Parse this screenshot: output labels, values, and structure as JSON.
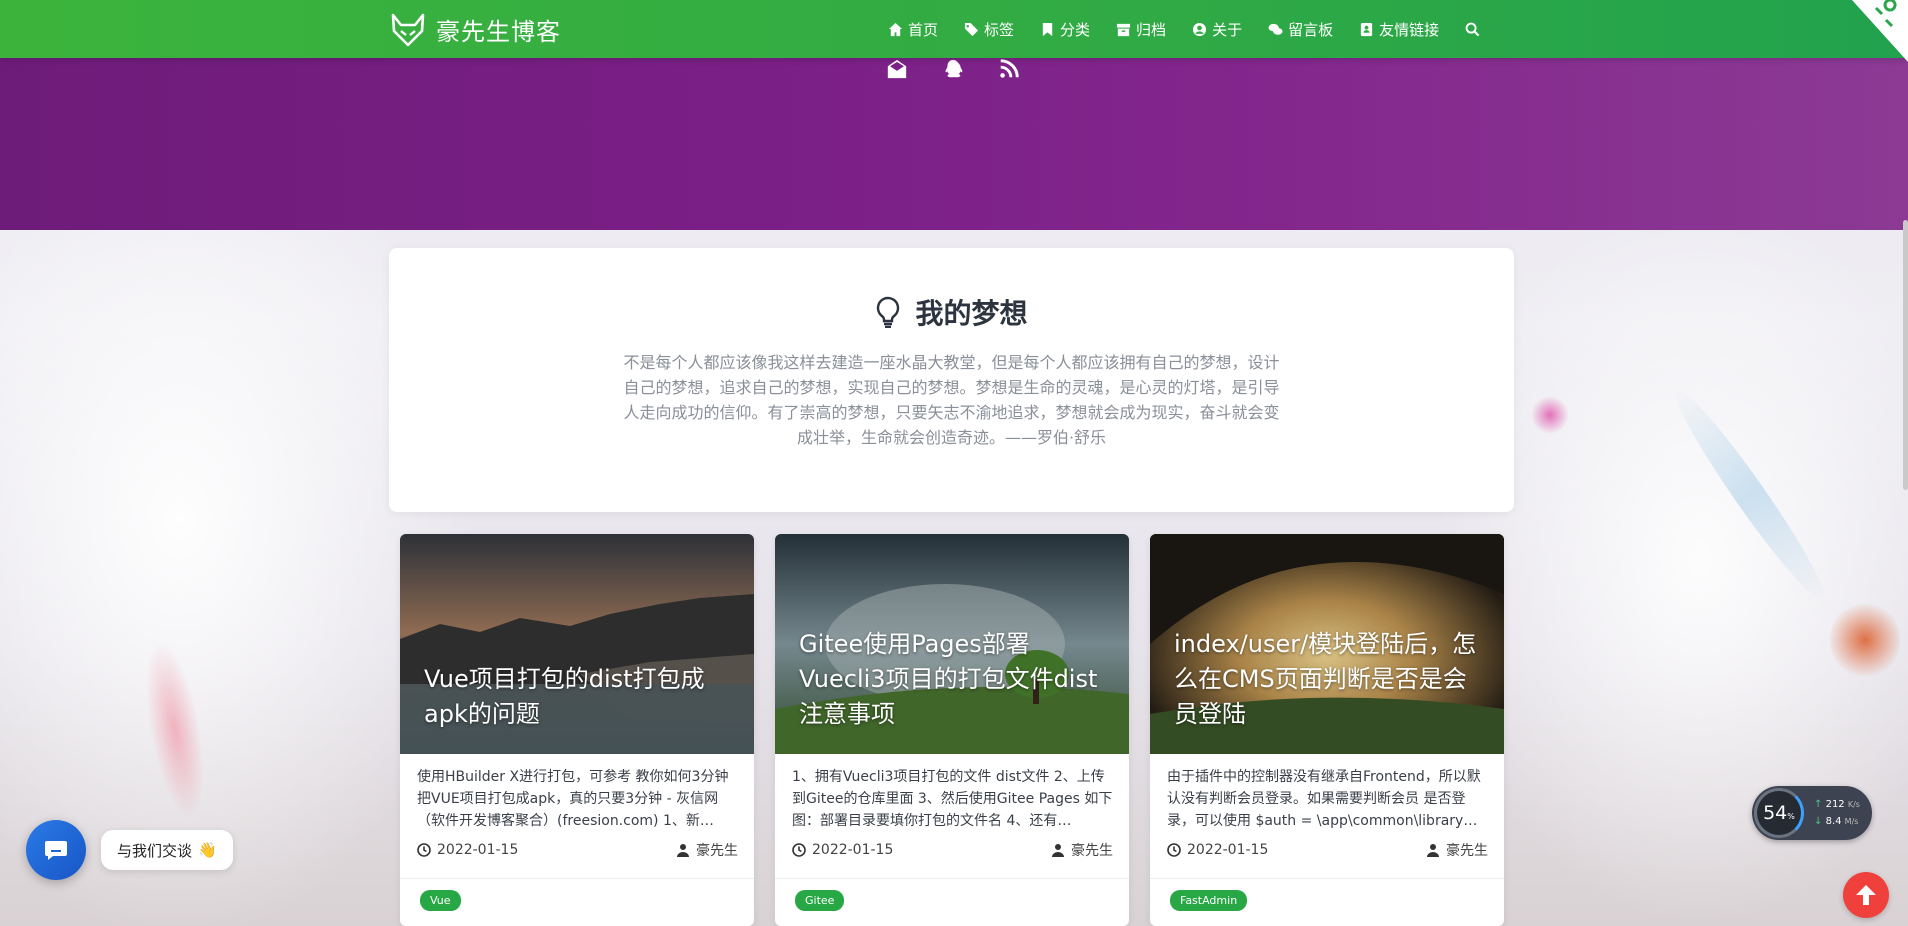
{
  "site": {
    "brand_name": "豪先生博客"
  },
  "nav": {
    "items": [
      {
        "label": "首页",
        "icon": "home-icon"
      },
      {
        "label": "标签",
        "icon": "tags-icon"
      },
      {
        "label": "分类",
        "icon": "bookmark-icon"
      },
      {
        "label": "归档",
        "icon": "archive-icon"
      },
      {
        "label": "关于",
        "icon": "user-circle-icon"
      },
      {
        "label": "留言板",
        "icon": "comments-icon"
      },
      {
        "label": "友情链接",
        "icon": "address-card-icon"
      }
    ],
    "search_icon": "search-icon"
  },
  "banner": {
    "icons": [
      "envelope-open-icon",
      "qq-icon",
      "rss-icon"
    ]
  },
  "dream": {
    "title": "我的梦想",
    "text": "不是每个人都应该像我这样去建造一座水晶大教堂，但是每个人都应该拥有自己的梦想，设计自己的梦想，追求自己的梦想，实现自己的梦想。梦想是生命的灵魂，是心灵的灯塔，是引导人走向成功的信仰。有了崇高的梦想，只要矢志不渝地追求，梦想就会成为现实，奋斗就会变成壮举，生命就会创造奇迹。——罗伯·舒乐"
  },
  "posts": [
    {
      "title": "Vue项目打包的dist打包成apk的问题",
      "excerpt": "使用HBuilder X进行打包，可参考 教你如何3分钟把VUE项目打包成apk，真的只要3分钟 - 灰信网（软件开发博客聚合）(freesion.com) 1、新…",
      "date": "2022-01-15",
      "author": "豪先生",
      "tag": "Vue"
    },
    {
      "title": "Gitee使用Pages部署Vuecli3项目的打包文件dist注意事项",
      "excerpt": "1、拥有Vuecli3项目打包的文件 dist文件 2、上传到Gitee的仓库里面 3、然后使用Gitee Pages 如下图：部署目录要填你打包的文件名 4、还有…",
      "date": "2022-01-15",
      "author": "豪先生",
      "tag": "Gitee"
    },
    {
      "title": "index/user/模块登陆后，怎么在CMS页面判断是否是会员登陆",
      "excerpt": "由于插件中的控制器没有继承自Frontend，所以默认没有判断会员登录。如果需要判断会员 是否登录，可以使用 $auth = \\app\\common\\library…",
      "date": "2022-01-15",
      "author": "豪先生",
      "tag": "FastAdmin"
    }
  ],
  "chat": {
    "label": "与我们交谈",
    "emoji": "👋"
  },
  "speed": {
    "percent": "54",
    "percent_unit": "%",
    "up": "212",
    "up_unit": "K/s",
    "down": "8.4",
    "down_unit": "M/s"
  },
  "colors": {
    "nav_green": "#3cb43c",
    "banner_purple": "#7a1f86",
    "tag_green": "#28a745",
    "top_button_red": "#f0403c"
  }
}
